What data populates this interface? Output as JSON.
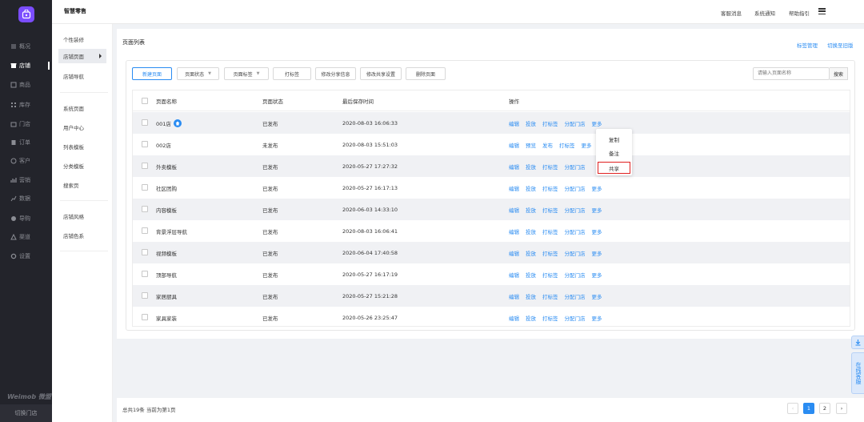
{
  "nav": {
    "items": [
      {
        "label": "概况",
        "icon": "overview-icon",
        "active": false
      },
      {
        "label": "店铺",
        "icon": "store-icon",
        "active": true
      },
      {
        "label": "商品",
        "icon": "goods-icon",
        "active": false
      },
      {
        "label": "库存",
        "icon": "inventory-icon",
        "active": false
      },
      {
        "label": "门店",
        "icon": "shop-icon",
        "active": false
      },
      {
        "label": "订单",
        "icon": "order-icon",
        "active": false
      },
      {
        "label": "客户",
        "icon": "customer-icon",
        "active": false
      },
      {
        "label": "营销",
        "icon": "marketing-icon",
        "active": false
      },
      {
        "label": "数据",
        "icon": "data-icon",
        "active": false
      },
      {
        "label": "导购",
        "icon": "guide-icon",
        "active": false
      },
      {
        "label": "渠道",
        "icon": "channel-icon",
        "active": false
      },
      {
        "label": "设置",
        "icon": "settings-icon",
        "active": false
      }
    ],
    "brand": "Weimob 微盟",
    "switch_store": "切换门店"
  },
  "topbar": {
    "title": "智慧零售",
    "links": [
      "客服消息",
      "系统通知",
      "帮助指引"
    ]
  },
  "subnav": {
    "group1": [
      "个性装修",
      "店铺页面",
      "店铺导航"
    ],
    "group2": [
      "系统页面",
      "用户中心",
      "列表模板",
      "分类模板",
      "搜索页"
    ],
    "group3": [
      "店铺风格",
      "店铺色系"
    ]
  },
  "main": {
    "title": "页面列表",
    "right_links": [
      "标签管理",
      "切换至旧版"
    ],
    "toolbar": {
      "new_page": "新建页面",
      "status_select": "页面状态",
      "tag_select": "页面标签",
      "tag_btn": "打标签",
      "share_info": "修改分享信息",
      "share_settings": "修改共享设置",
      "delete": "删除页面",
      "search_placeholder": "请输入页面名称",
      "search_btn": "搜索"
    },
    "table": {
      "headers": [
        "页面名称",
        "页面状态",
        "最后保存时间",
        "操作"
      ],
      "rows": [
        {
          "name": "001店",
          "status": "已发布",
          "time": "2020-08-03 16:06:33",
          "actions": [
            "编辑",
            "投放",
            "打标签",
            "分配门店",
            "更多"
          ],
          "home": true
        },
        {
          "name": "002店",
          "status": "未发布",
          "time": "2020-08-03 15:51:03",
          "actions": [
            "编辑",
            "预览",
            "发布",
            "打标签",
            "更多"
          ],
          "home": false
        },
        {
          "name": "外卖模板",
          "status": "已发布",
          "time": "2020-05-27 17:27:32",
          "actions": [
            "编辑",
            "投放",
            "打标签",
            "分配门店"
          ],
          "home": false
        },
        {
          "name": "社区团购",
          "status": "已发布",
          "time": "2020-05-27 16:17:13",
          "actions": [
            "编辑",
            "投放",
            "打标签",
            "分配门店",
            "更多"
          ],
          "home": false
        },
        {
          "name": "内容模板",
          "status": "已发布",
          "time": "2020-06-03 14:33:10",
          "actions": [
            "编辑",
            "投放",
            "打标签",
            "分配门店",
            "更多"
          ],
          "home": false
        },
        {
          "name": "背景浮层导航",
          "status": "已发布",
          "time": "2020-08-03 16:06:41",
          "actions": [
            "编辑",
            "投放",
            "打标签",
            "分配门店",
            "更多"
          ],
          "home": false
        },
        {
          "name": "视频模板",
          "status": "已发布",
          "time": "2020-06-04 17:40:58",
          "actions": [
            "编辑",
            "投放",
            "打标签",
            "分配门店",
            "更多"
          ],
          "home": false
        },
        {
          "name": "顶部导航",
          "status": "已发布",
          "time": "2020-05-27 16:17:19",
          "actions": [
            "编辑",
            "投放",
            "打标签",
            "分配门店",
            "更多"
          ],
          "home": false
        },
        {
          "name": "家居厨具",
          "status": "已发布",
          "time": "2020-05-27 15:21:28",
          "actions": [
            "编辑",
            "投放",
            "打标签",
            "分配门店",
            "更多"
          ],
          "home": false
        },
        {
          "name": "家具家装",
          "status": "已发布",
          "time": "2020-05-26 23:25:47",
          "actions": [
            "编辑",
            "投放",
            "打标签",
            "分配门店",
            "更多"
          ],
          "home": false
        }
      ]
    },
    "more_menu": [
      "复制",
      "备注",
      "共享"
    ]
  },
  "footer": {
    "total": "总共19条 当前为第1页",
    "pages": [
      "1",
      "2"
    ]
  },
  "floating": {
    "download_icon": "download-icon",
    "online_service": "在线客服"
  },
  "colors": {
    "accent": "#2a8cf2",
    "nav_bg": "#23242b",
    "highlight": "#e02020"
  }
}
